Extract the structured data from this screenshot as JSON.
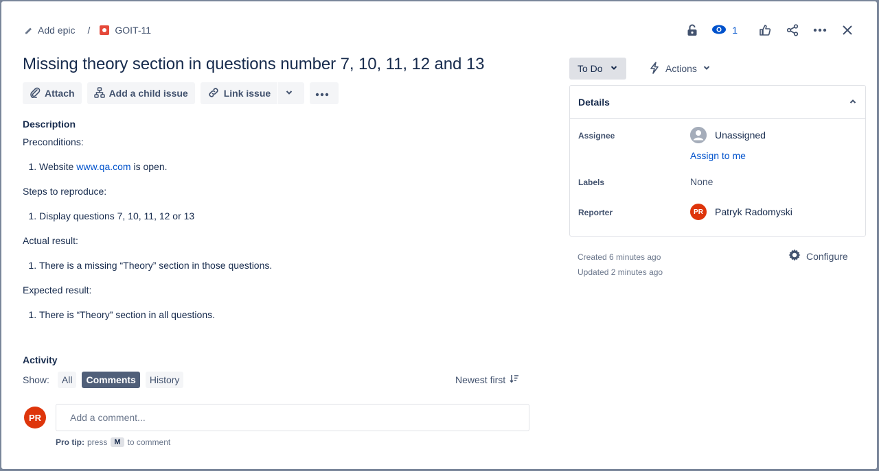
{
  "breadcrumb": {
    "add_epic": "Add epic",
    "separator": "/",
    "issue_key": "GOIT-11"
  },
  "header": {
    "watchers_count": "1",
    "icons": [
      "lock-icon",
      "eye-icon",
      "thumbs-up-icon",
      "share-icon",
      "more-icon",
      "close-icon"
    ]
  },
  "issue": {
    "title": "Missing theory section in questions number 7, 10, 11, 12 and 13"
  },
  "toolbar": {
    "attach": "Attach",
    "add_child": "Add a child issue",
    "link_issue": "Link issue"
  },
  "description": {
    "heading": "Description",
    "preconditions": "Preconditions:",
    "pre_item_prefix": "Website ",
    "pre_item_link": "www.qa.com",
    "pre_item_suffix": " is open.",
    "steps": "Steps to reproduce:",
    "steps_item": "Display questions 7, 10, 11, 12 or 13",
    "actual": "Actual result:",
    "actual_item": "There is a missing “Theory” section in those questions.",
    "expected": "Expected result:",
    "expected_item": "There is “Theory” section in all questions."
  },
  "activity": {
    "heading": "Activity",
    "show_label": "Show:",
    "filters": [
      "All",
      "Comments",
      "History"
    ],
    "active_filter": "Comments",
    "sort": "Newest first",
    "comment_placeholder": "Add a comment...",
    "protip_bold": "Pro tip:",
    "protip_press": "press",
    "protip_key": "M",
    "protip_rest": "to comment",
    "user_initials": "PR"
  },
  "status": {
    "current": "To Do",
    "actions": "Actions"
  },
  "details": {
    "heading": "Details",
    "assignee_label": "Assignee",
    "assignee_value": "Unassigned",
    "assign_to_me": "Assign to me",
    "labels_label": "Labels",
    "labels_value": "None",
    "reporter_label": "Reporter",
    "reporter_value": "Patryk Radomyski",
    "reporter_initials": "PR"
  },
  "meta": {
    "created": "Created 6 minutes ago",
    "updated": "Updated 2 minutes ago",
    "configure": "Configure"
  },
  "colors": {
    "bug_red": "#e5493a",
    "link_blue": "#0052cc",
    "avatar_red": "#de350b",
    "active_pill": "#505f79"
  }
}
